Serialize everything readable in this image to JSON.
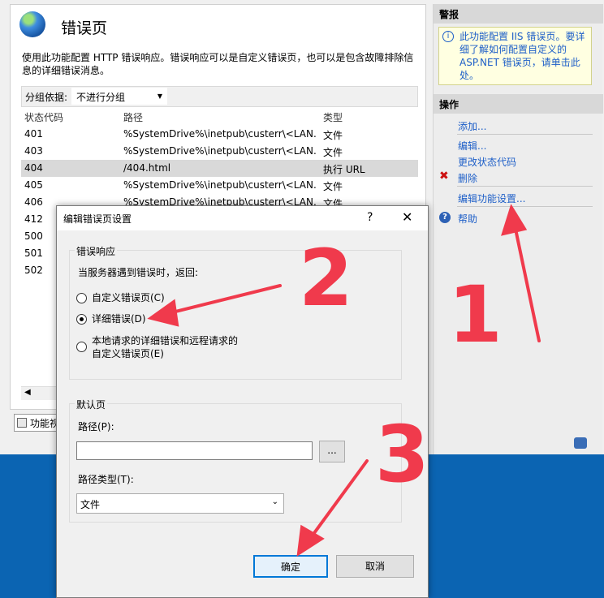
{
  "page": {
    "title": "错误页",
    "description": "使用此功能配置 HTTP 错误响应。错误响应可以是自定义错误页，也可以是包含故障排除信息的详细错误消息。",
    "group_by_label": "分组依据:",
    "group_by_value": "不进行分组",
    "columns": [
      "状态代码",
      "路径",
      "类型"
    ],
    "rows": [
      {
        "code": "401",
        "path": "%SystemDrive%\\inetpub\\custerr\\<LAN...",
        "type": "文件"
      },
      {
        "code": "403",
        "path": "%SystemDrive%\\inetpub\\custerr\\<LAN...",
        "type": "文件"
      },
      {
        "code": "404",
        "path": "/404.html",
        "type": "执行 URL"
      },
      {
        "code": "405",
        "path": "%SystemDrive%\\inetpub\\custerr\\<LAN...",
        "type": "文件"
      },
      {
        "code": "406",
        "path": "%SystemDrive%\\inetpub\\custerr\\<LAN...",
        "type": "文件"
      },
      {
        "code": "412",
        "path": "",
        "type": ""
      },
      {
        "code": "500",
        "path": "",
        "type": ""
      },
      {
        "code": "501",
        "path": "",
        "type": ""
      },
      {
        "code": "502",
        "path": "",
        "type": ""
      }
    ],
    "feature_tab": "功能视图"
  },
  "right": {
    "alert_header": "警报",
    "alert_text": "此功能配置 IIS 错误页。要详细了解如何配置自定义的 ASP.NET 错误页，请单击此处。",
    "actions_header": "操作",
    "add": "添加...",
    "edit": "编辑...",
    "change_code": "更改状态代码",
    "delete": "删除",
    "edit_feature": "编辑功能设置...",
    "help": "帮助"
  },
  "dialog": {
    "title": "编辑错误页设置",
    "help_glyph": "?",
    "close_glyph": "✕",
    "group1_label": "错误响应",
    "prompt": "当服务器遇到错误时，返回:",
    "opt_custom": "自定义错误页(C)",
    "opt_detailed": "详细错误(D)",
    "opt_local_line1": "本地请求的详细错误和远程请求的",
    "opt_local_line2": "自定义错误页(E)",
    "selected": "detailed",
    "group2_label": "默认页",
    "path_label": "路径(P):",
    "path_value": "",
    "browse": "...",
    "path_type_label": "路径类型(T):",
    "path_type_value": "文件",
    "ok": "确定",
    "cancel": "取消"
  },
  "annotations": {
    "n1": "1",
    "n2": "2",
    "n3": "3",
    "color": "#f03a4c"
  }
}
